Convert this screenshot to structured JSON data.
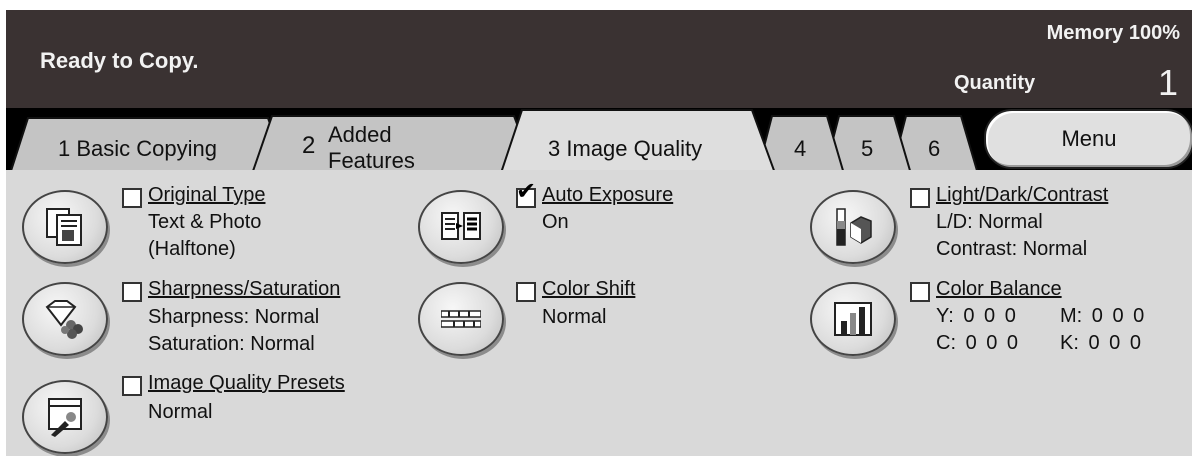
{
  "status": {
    "message": "Ready to Copy.",
    "memory": "Memory 100%",
    "quantity_label": "Quantity",
    "quantity_value": "1"
  },
  "tabs": [
    {
      "number": "1",
      "label": "Basic Copying",
      "active": false
    },
    {
      "number": "2",
      "label": "Added",
      "label2": "Features",
      "active": false
    },
    {
      "number": "3",
      "label": "Image Quality",
      "active": true
    },
    {
      "number": "4",
      "label": "",
      "active": false
    },
    {
      "number": "5",
      "label": "",
      "active": false
    },
    {
      "number": "6",
      "label": "",
      "active": false
    }
  ],
  "menu_label": "Menu",
  "features": {
    "original_type": {
      "title": "Original Type",
      "checked": false,
      "value1": "Text & Photo",
      "value2": "(Halftone)"
    },
    "sharpness": {
      "title": "Sharpness/Saturation",
      "checked": false,
      "value1": "Sharpness: Normal",
      "value2": "Saturation: Normal"
    },
    "presets": {
      "title": "Image Quality Presets",
      "checked": false,
      "value1": "Normal"
    },
    "auto_exposure": {
      "title": "Auto Exposure",
      "checked": true,
      "value1": "On"
    },
    "color_shift": {
      "title": "Color Shift",
      "checked": false,
      "value1": "Normal"
    },
    "light_dark": {
      "title": "Light/Dark/Contrast",
      "checked": false,
      "value1": "L/D: Normal",
      "value2": "Contrast: Normal"
    },
    "color_balance": {
      "title": "Color Balance",
      "checked": false,
      "y_label": "Y:",
      "y_values": "0 0 0",
      "m_label": "M:",
      "m_values": "0 0 0",
      "c_label": "C:",
      "c_values": "0 0 0",
      "k_label": "K:",
      "k_values": "0 0 0"
    }
  },
  "checkmark_glyph": "✔",
  "icons": [
    "original-type-icon",
    "sharpness-icon",
    "presets-icon",
    "auto-exposure-icon",
    "color-shift-icon",
    "light-dark-icon",
    "color-balance-icon"
  ],
  "colors": {
    "header_bg": "#3a3232",
    "panel_bg": "#d9d9d9",
    "tab_active": "#dedede",
    "tab_inactive": "#c4c4c4"
  }
}
